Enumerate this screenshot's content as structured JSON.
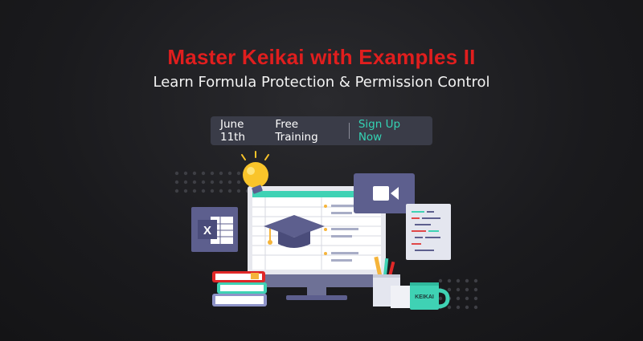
{
  "banner": {
    "title": "Master Keikai with Examples II",
    "subtitle": "Learn Formula Protection & Permission Control",
    "date": "June 11th",
    "event": "Free Training",
    "cta": "Sign Up Now",
    "mug_label": "KEIKAI",
    "excel_letter": "X"
  },
  "colors": {
    "title": "#e01e1e",
    "cta": "#34d3b4",
    "pill_bg": "#3a3c48",
    "accent_purple": "#5d5f8e",
    "bulb": "#f9c42a"
  },
  "icons": [
    "lightbulb-icon",
    "video-camera-icon",
    "graduation-cap-icon",
    "excel-icon",
    "code-document-icon",
    "book-stack-icon",
    "pencil-cup-icon",
    "keikai-mug-icon",
    "monitor-icon"
  ]
}
